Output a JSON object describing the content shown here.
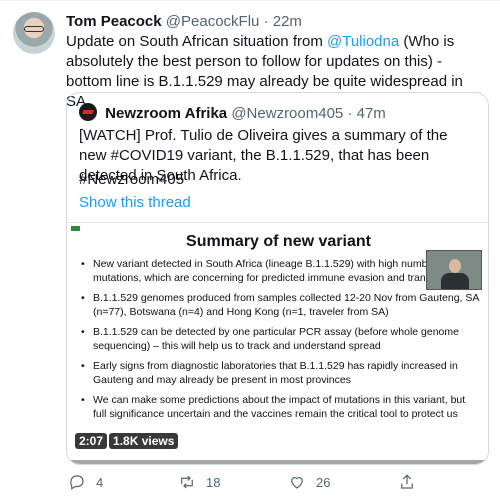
{
  "tweet": {
    "author_name": "Tom Peacock",
    "author_handle": "@PeacockFlu",
    "dot": "·",
    "time": "22m",
    "text_before": "Update on South African situation from ",
    "mention": "@Tuliodna",
    "text_after": " (Who is absolutely the best person to follow for updates on this) - bottom line is B.1.1.529 may already be quite widespread in SA."
  },
  "quote": {
    "author_name": "Newzroom Afrika",
    "author_handle": "@Newzroom405",
    "dot": "·",
    "time": "47m",
    "text": "[WATCH] Prof. Tulio de Oliveira gives a summary of the new #COVID19 variant, the B.1.1.529, that has been detected in South Africa.",
    "hashtag": "#Newzroom405",
    "show_thread": "Show this thread"
  },
  "video": {
    "slide_title": "Summary of new variant",
    "bullets": [
      "New variant detected in South Africa (lineage B.1.1.529) with high number mutations, which are concerning for predicted immune evasion and transmissibility",
      "B.1.1.529 genomes produced from samples collected 12-20 Nov from Gauteng, SA (n=77), Botswana (n=4) and Hong Kong (n=1, traveler from SA)",
      "B.1.1.529 can be detected by one particular PCR assay (before whole genome sequencing) – this will help us to track and understand spread",
      "Early signs from diagnostic laboratories that B.1.1.529 has rapidly increased in Gauteng and may already be present in most provinces",
      "We can make some predictions about the impact of mutations in this variant, but full significance uncertain and the vaccines remain the critical tool to protect us"
    ],
    "duration": "2:07",
    "views": "1.8K views"
  },
  "actions": {
    "replies": "4",
    "retweets": "18",
    "likes": "26"
  }
}
